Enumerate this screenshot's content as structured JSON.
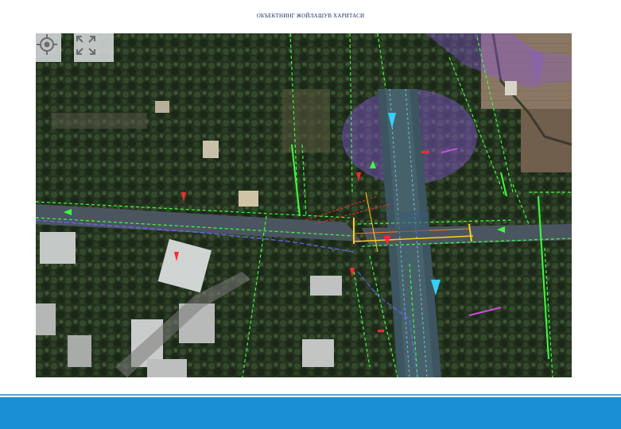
{
  "title": "ОБЪЕКТНИНГ ЖОЙЛАШУВ ХАРИТАСИ",
  "map": {
    "controls": [
      {
        "name": "locate-icon"
      },
      {
        "name": "expand-icon"
      }
    ],
    "colors": {
      "vegetation": "#23331f",
      "road": "#4b5560",
      "canal": "#3d5560",
      "boundary_line": "#3cff3c",
      "flow_arrow": "#35d0ff",
      "marker": "#ff2a2a",
      "zone": "#8a58d8",
      "crossing": "#ffcf1a"
    }
  },
  "footer": {
    "color": "#1b8fd6"
  }
}
